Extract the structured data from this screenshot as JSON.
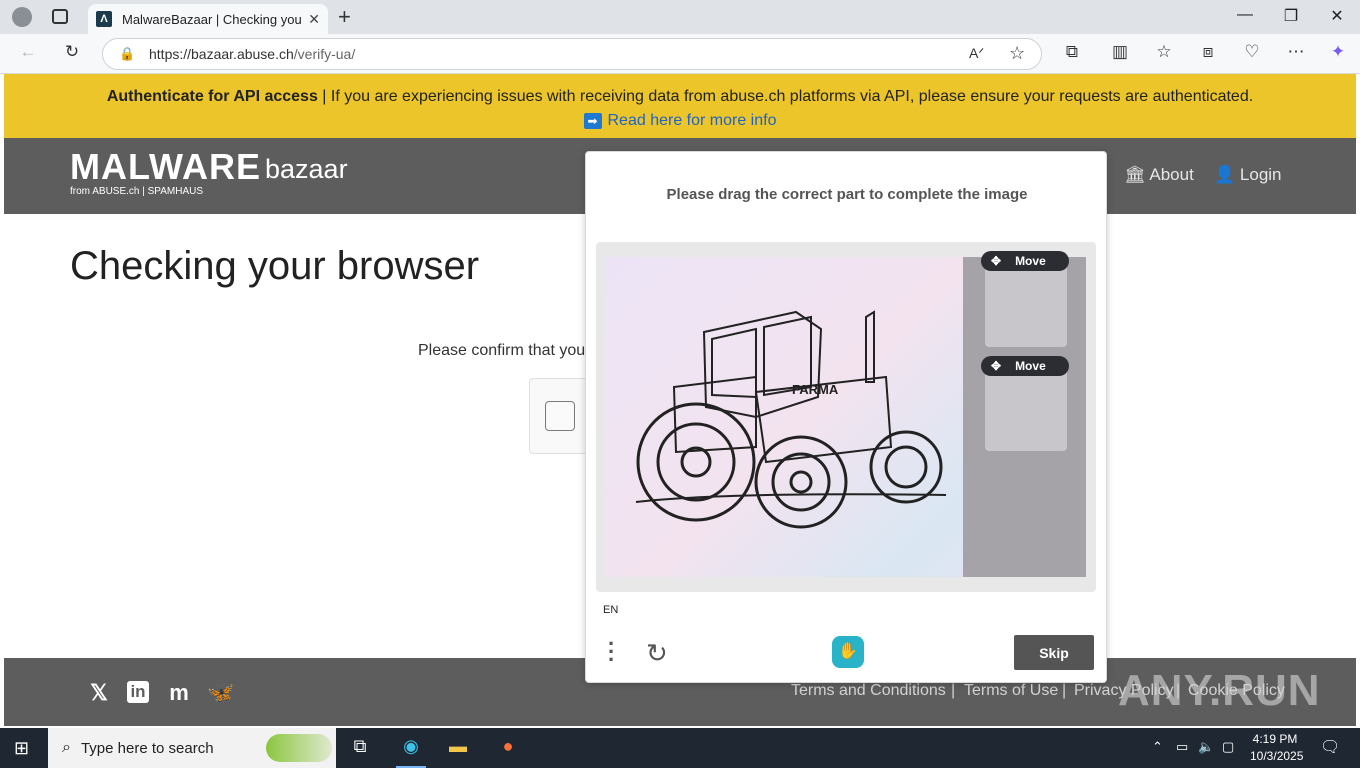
{
  "browser": {
    "tab_title": "MalwareBazaar | Checking your browser",
    "url_host": "https://bazaar.abuse.ch",
    "url_path": "/verify-ua/"
  },
  "banner": {
    "bold": "Authenticate for API access",
    "text": " | If you are experiencing issues with receiving data from abuse.ch platforms via API, please ensure your requests are authenticated.",
    "link": "Read here for more info"
  },
  "nav": {
    "logo_main": "MALWARE",
    "logo_sub": "bazaar",
    "logo_from": "from ABUSE.ch | SPAMHAUS",
    "about": "About",
    "login": "Login"
  },
  "main": {
    "heading": "Checking your browser",
    "confirm_text": "Please confirm that you"
  },
  "captcha": {
    "prompt": "Please drag the correct part to complete the image",
    "move_label": "Move",
    "image_label": "FARMA",
    "language": "EN",
    "skip_label": "Skip"
  },
  "footer": {
    "links": [
      "Terms and Conditions",
      "Terms of Use",
      "Privacy Policy",
      "Cookie Policy"
    ],
    "separator": "|",
    "watermark": "ANY.RUN"
  },
  "taskbar": {
    "search_placeholder": "Type here to search",
    "time": "4:19 PM",
    "date": "10/3/2025"
  },
  "colors": {
    "banner": "#ecc52a",
    "navbar": "#5d5d5d",
    "link": "#1f63c6",
    "skip_button": "#555555"
  }
}
